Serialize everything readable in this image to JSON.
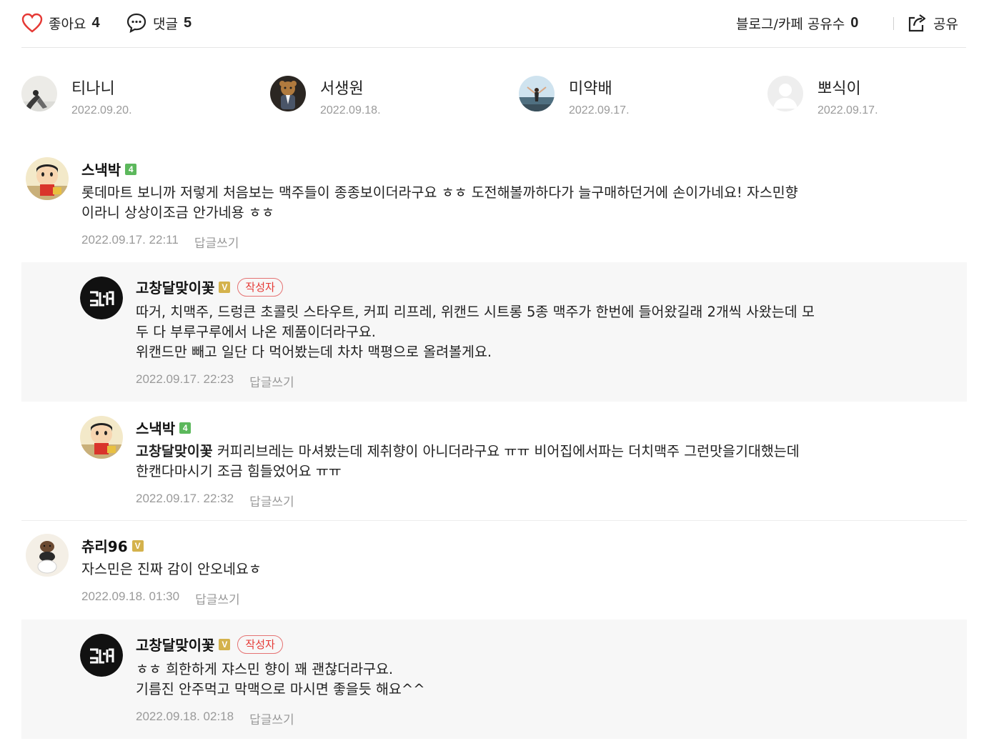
{
  "actions": {
    "like_label": "좋아요",
    "like_count": "4",
    "comment_label": "댓글",
    "comment_count": "5",
    "share_count_label": "블로그/카페 공유수",
    "share_count": "0",
    "share_label": "공유"
  },
  "likers": [
    {
      "name": "티나니",
      "date": "2022.09.20."
    },
    {
      "name": "서생원",
      "date": "2022.09.18."
    },
    {
      "name": "미약배",
      "date": "2022.09.17."
    },
    {
      "name": "뽀식이",
      "date": "2022.09.17."
    }
  ],
  "comments": [
    {
      "author": "스낵박",
      "level": "4",
      "text": "롯데마트 보니까 저렇게 처음보는 맥주들이 종종보이더라구요 ㅎㅎ 도전해볼까하다가 늘구매하던거에 손이가네요! 자스민향\n이라니 상상이조금 안가네용 ㅎㅎ",
      "time": "2022.09.17. 22:11",
      "reply_label": "답글쓰기"
    },
    {
      "author": "고창달맞이꽃",
      "level": "V",
      "writer_tag": "작성자",
      "text": "따거, 치맥주, 드렁큰 초콜릿 스타우트, 커피 리프레, 위캔드 시트롱 5종 맥주가 한번에 들어왔길래 2개씩 사왔는데 모\n두 다 부루구루에서 나온 제품이더라구요.\n위캔드만 빼고 일단 다 먹어봤는데 차차 맥평으로 올려볼게요.",
      "time": "2022.09.17. 22:23",
      "reply_label": "답글쓰기"
    },
    {
      "author": "스낵박",
      "level": "4",
      "mention": "고창달맞이꽃",
      "text": " 커피리브레는 마셔봤는데 제취향이 아니더라구요 ㅠㅠ 비어집에서파는 더치맥주 그런맛을기대했는데\n한캔다마시기 조금 힘들었어요 ㅠㅠ",
      "time": "2022.09.17. 22:32",
      "reply_label": "답글쓰기"
    },
    {
      "author": "츄리96",
      "level": "V",
      "text": "자스민은 진짜 감이 안오네요ㅎ",
      "time": "2022.09.18. 01:30",
      "reply_label": "답글쓰기"
    },
    {
      "author": "고창달맞이꽃",
      "level": "V",
      "writer_tag": "작성자",
      "text": "ㅎㅎ 희한하게 쟈스민 향이 꽤 괜찮더라구요.\n기름진 안주먹고 막맥으로 마시면 좋을듯 해요^^",
      "time": "2022.09.18. 02:18",
      "reply_label": "답글쓰기"
    }
  ],
  "colors": {
    "like_heart": "#e53935",
    "writer_tag": "#e53935",
    "reply_bg": "#f7f7f7",
    "meta_gray": "#9a9a9a"
  }
}
